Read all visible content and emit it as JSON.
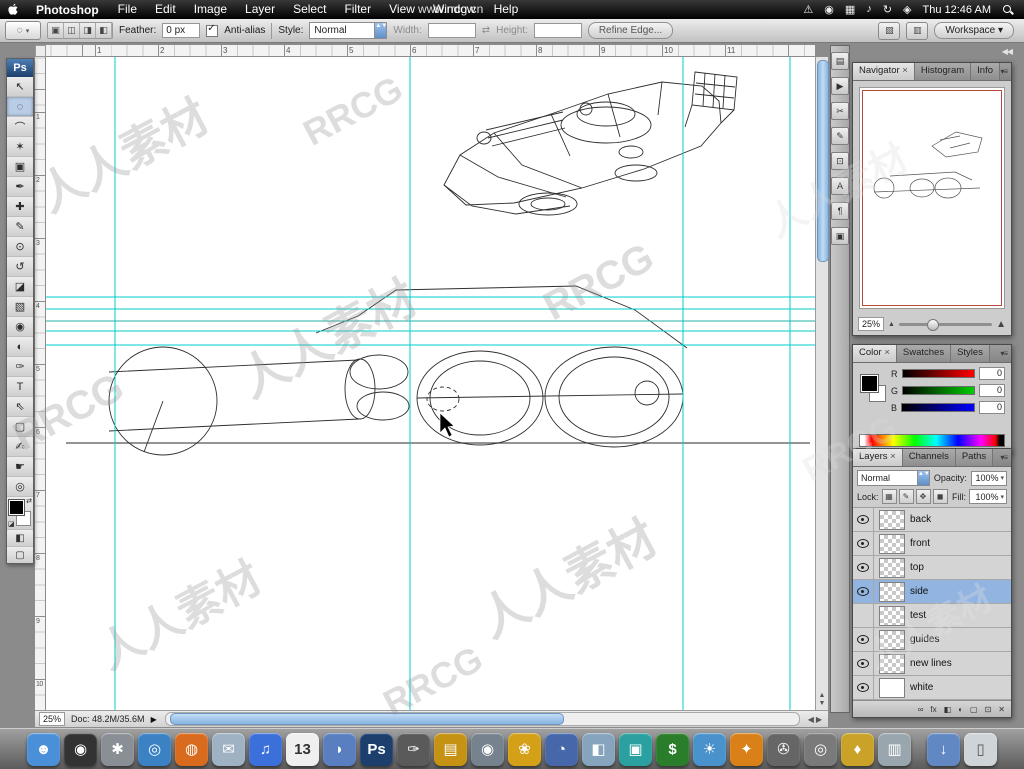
{
  "menubar": {
    "app_name": "Photoshop",
    "items": [
      "File",
      "Edit",
      "Image",
      "Layer",
      "Select",
      "Filter",
      "View",
      "Window",
      "Help"
    ],
    "status_icons": [
      {
        "name": "script-status-icon",
        "glyph": "⚠"
      },
      {
        "name": "display-status-icon",
        "glyph": "◉"
      },
      {
        "name": "spaces-status-icon",
        "glyph": "▦"
      },
      {
        "name": "volume-status-icon",
        "glyph": "♪"
      },
      {
        "name": "sync-status-icon",
        "glyph": "↻"
      },
      {
        "name": "bluetooth-status-icon",
        "glyph": "◈"
      }
    ],
    "clock": "Thu 12:46 AM"
  },
  "options_bar": {
    "tool_glyph": "◌",
    "selection_modes": [
      "▣",
      "◫",
      "◨",
      "◧"
    ],
    "feather_label": "Feather:",
    "feather_value": "0 px",
    "antialias_label": "Anti-alias",
    "style_label": "Style:",
    "style_value": "Normal",
    "width_label": "Width:",
    "width_value": "",
    "height_label": "Height:",
    "height_value": "",
    "refine_edge_label": "Refine Edge...",
    "workspace_label": "Workspace ▾"
  },
  "toolbar": {
    "logo": "Ps",
    "tools": [
      {
        "name": "move",
        "glyph": "↖"
      },
      {
        "name": "elliptical-marquee",
        "glyph": "◌",
        "selected": true
      },
      {
        "name": "lasso",
        "glyph": "⌒"
      },
      {
        "name": "magic-wand",
        "glyph": "✶"
      },
      {
        "name": "crop",
        "glyph": "▣"
      },
      {
        "name": "eyedropper",
        "glyph": "✒"
      },
      {
        "name": "healing-brush",
        "glyph": "✚"
      },
      {
        "name": "brush",
        "glyph": "✎"
      },
      {
        "name": "clone-stamp",
        "glyph": "⊙"
      },
      {
        "name": "history-brush",
        "glyph": "↺"
      },
      {
        "name": "eraser",
        "glyph": "◪"
      },
      {
        "name": "gradient",
        "glyph": "▧"
      },
      {
        "name": "blur",
        "glyph": "◉"
      },
      {
        "name": "dodge",
        "glyph": "◐"
      },
      {
        "name": "pen",
        "glyph": "✑"
      },
      {
        "name": "type",
        "glyph": "T"
      },
      {
        "name": "path-select",
        "glyph": "⇖"
      },
      {
        "name": "shape",
        "glyph": "▢"
      },
      {
        "name": "notes",
        "glyph": "✍"
      },
      {
        "name": "hand",
        "glyph": "☛"
      },
      {
        "name": "zoom",
        "glyph": "◎"
      }
    ]
  },
  "rulers": {
    "top": [
      "1",
      "2",
      "3",
      "4",
      "5",
      "6",
      "7",
      "8",
      "9",
      "10",
      "11"
    ],
    "left": [
      "1",
      "2",
      "3",
      "4",
      "5",
      "6",
      "7",
      "8",
      "9",
      "10"
    ]
  },
  "collapsed_panels": [
    {
      "name": "history",
      "glyph": "▤"
    },
    {
      "name": "actions",
      "glyph": "▶"
    },
    {
      "name": "tool-presets",
      "glyph": "✂"
    },
    {
      "name": "brushes",
      "glyph": "✎"
    },
    {
      "name": "clone-source",
      "glyph": "⊡"
    },
    {
      "name": "character",
      "glyph": "A"
    },
    {
      "name": "paragraph",
      "glyph": "¶"
    },
    {
      "name": "layer-comps",
      "glyph": "▣"
    }
  ],
  "panels": {
    "navigator": {
      "tabs": [
        {
          "label": "Navigator",
          "selected": true
        },
        {
          "label": "Histogram"
        },
        {
          "label": "Info"
        }
      ],
      "zoom": "25%"
    },
    "color": {
      "tabs": [
        {
          "label": "Color",
          "selected": true
        },
        {
          "label": "Swatches"
        },
        {
          "label": "Styles"
        }
      ],
      "channels": [
        {
          "label": "R",
          "value": "0"
        },
        {
          "label": "G",
          "value": "0"
        },
        {
          "label": "B",
          "value": "0"
        }
      ]
    },
    "layers": {
      "tabs": [
        {
          "label": "Layers",
          "selected": true
        },
        {
          "label": "Channels"
        },
        {
          "label": "Paths"
        }
      ],
      "blend_mode": "Normal",
      "opacity_label": "Opacity:",
      "opacity_value": "100%",
      "lock_label": "Lock:",
      "lock_icons": [
        "▦",
        "✎",
        "✥",
        "◼"
      ],
      "fill_label": "Fill:",
      "fill_value": "100%",
      "layers": [
        {
          "name": "back",
          "visible": true
        },
        {
          "name": "front",
          "visible": true
        },
        {
          "name": "top",
          "visible": true
        },
        {
          "name": "side",
          "visible": true,
          "selected": true
        },
        {
          "name": "test",
          "visible": false
        },
        {
          "name": "guides",
          "visible": true
        },
        {
          "name": "new lines",
          "visible": true
        },
        {
          "name": "white",
          "visible": true,
          "thumb": "white"
        }
      ],
      "footer_icons": [
        "∞",
        "fx",
        "◧",
        "◐",
        "▢",
        "⊡",
        "✕"
      ]
    }
  },
  "document": {
    "status_zoom": "25%",
    "doc_info": "Doc: 48.2M/35.6M",
    "guide_color": "#00cccc"
  },
  "dock": {
    "items": [
      {
        "name": "finder",
        "glyph": "☻",
        "color": "#4a90d9"
      },
      {
        "name": "dashboard",
        "glyph": "◉",
        "color": "#333333"
      },
      {
        "name": "system-preferences",
        "glyph": "✱",
        "color": "#8a8f96"
      },
      {
        "name": "safari",
        "glyph": "◎",
        "color": "#3b82c4"
      },
      {
        "name": "firefox",
        "glyph": "◍",
        "color": "#d96b1f"
      },
      {
        "name": "mail",
        "glyph": "✉",
        "color": "#9fb2c4"
      },
      {
        "name": "itunes",
        "glyph": "♫",
        "color": "#3b6fd9"
      },
      {
        "name": "ical",
        "glyph": "13",
        "color": "#efefef",
        "fg": "#333333"
      },
      {
        "name": "ichat",
        "glyph": "◗",
        "color": "#5a7fc0"
      },
      {
        "name": "photoshop",
        "glyph": "Ps",
        "color": "#1c3f6e"
      },
      {
        "name": "pen-app",
        "glyph": "✑",
        "color": "#5a5a5a"
      },
      {
        "name": "notes",
        "glyph": "▤",
        "color": "#c69214"
      },
      {
        "name": "camera-app",
        "glyph": "◉",
        "color": "#76828e"
      },
      {
        "name": "iphoto",
        "glyph": "❀",
        "color": "#d4a017"
      },
      {
        "name": "quicktime",
        "glyph": "◔",
        "color": "#4668aa"
      },
      {
        "name": "preview",
        "glyph": "◧",
        "color": "#86a4bd"
      },
      {
        "name": "photo-booth",
        "glyph": "▣",
        "color": "#2aa0a0"
      },
      {
        "name": "stocks",
        "glyph": "$",
        "color": "#2a7d2a"
      },
      {
        "name": "weather",
        "glyph": "☀",
        "color": "#4992cc"
      },
      {
        "name": "aperture",
        "glyph": "✦",
        "color": "#d98019"
      },
      {
        "name": "movies",
        "glyph": "✇",
        "color": "#666666"
      },
      {
        "name": "dvd-player",
        "glyph": "◎",
        "color": "#7a7a7a"
      },
      {
        "name": "gold-app",
        "glyph": "♦",
        "color": "#c9a227"
      },
      {
        "name": "hard-drive",
        "glyph": "▥",
        "color": "#99a6ad"
      },
      {
        "name": "downloads",
        "glyph": "↓",
        "color": "#6288c4"
      },
      {
        "name": "trash",
        "glyph": "▯",
        "color": "#cfd4d8",
        "fg": "#555555"
      }
    ]
  },
  "watermarks": {
    "url": "www.rrcg.cn",
    "texts": [
      "人人素材",
      "RRCG",
      "人人素材",
      "RRCG",
      "人人素材",
      "RRCG",
      "人人素材",
      "RRCG",
      "人人素材",
      "RRCG",
      "人人素材"
    ]
  }
}
